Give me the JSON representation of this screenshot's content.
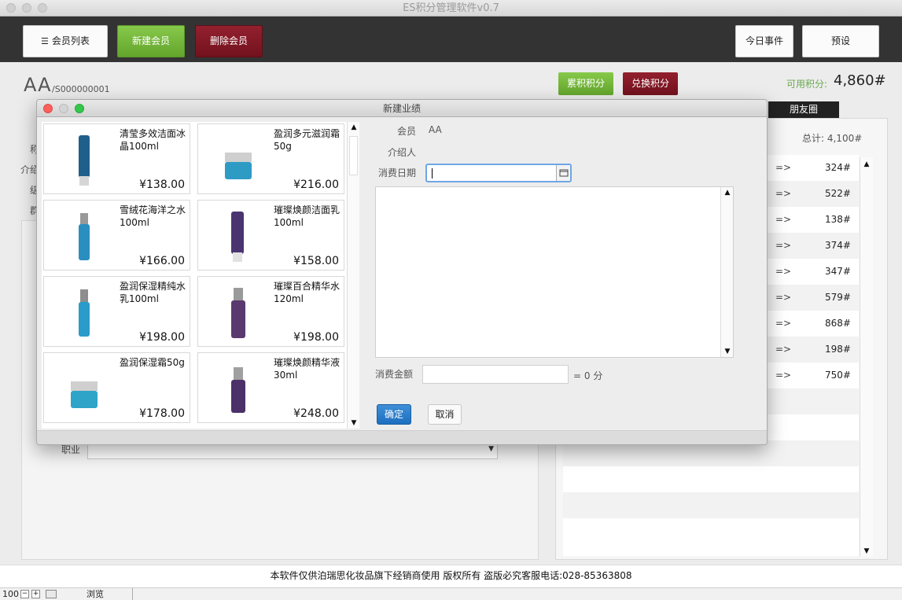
{
  "window": {
    "title": "ES积分管理软件v0.7"
  },
  "toolbar": {
    "member_list": "会员列表",
    "new_member": "新建会员",
    "delete_member": "删除会员",
    "today_events": "今日事件",
    "preset": "预设"
  },
  "member": {
    "name": "AA",
    "id": "/S000000001",
    "accumulate_label": "累积积分",
    "exchange_label": "兑换积分",
    "available_label": "可用积分:",
    "available_value": "4,860#",
    "field_labels": [
      "称",
      "介绍",
      "级",
      "群"
    ],
    "occupation_label": "职业"
  },
  "right_panel": {
    "tab_friends": "朋友圈",
    "total": "总计: 4,100#",
    "rows": [
      {
        "arrow": "=>",
        "points": "324#"
      },
      {
        "arrow": "=>",
        "points": "522#"
      },
      {
        "arrow": "=>",
        "points": "138#"
      },
      {
        "arrow": "=>",
        "points": "374#"
      },
      {
        "arrow": "=>",
        "points": "347#"
      },
      {
        "arrow": "=>",
        "points": "579#"
      },
      {
        "arrow": "=>",
        "points": "868#"
      },
      {
        "arrow": "=>",
        "points": "198#"
      },
      {
        "arrow": "=>",
        "points": "750#"
      }
    ]
  },
  "footer": {
    "text": "本软件仅供泊瑞思化妆品旗下经销商使用 版权所有 盗版必究客服电话:028-85363808"
  },
  "statusbar": {
    "zoom": "100",
    "mode": "浏览"
  },
  "dialog": {
    "title": "新建业绩",
    "member_label": "会员",
    "member_value": "AA",
    "referrer_label": "介绍人",
    "date_label": "消费日期",
    "amount_label": "消费金额",
    "amount_points": "= 0 分",
    "ok": "确定",
    "cancel": "取消",
    "products": [
      {
        "name": "清莹多效洁面冰晶100ml",
        "price": "¥138.00",
        "color": "#1f5f8c"
      },
      {
        "name": "盈润多元滋润霜50g",
        "price": "¥216.00",
        "color": "#2e9bc4"
      },
      {
        "name": "雪绒花海洋之水100ml",
        "price": "¥166.00",
        "color": "#2a8fc0"
      },
      {
        "name": "璀璨焕颜洁面乳100ml",
        "price": "¥158.00",
        "color": "#4a3470"
      },
      {
        "name": "盈润保湿精纯水乳100ml",
        "price": "¥198.00",
        "color": "#2a9bcb"
      },
      {
        "name": "璀璨百合精华水120ml",
        "price": "¥198.00",
        "color": "#5a3a6e"
      },
      {
        "name": "盈润保湿霜50g",
        "price": "¥178.00",
        "color": "#2ea4c9"
      },
      {
        "name": "璀璨焕颜精华液30ml",
        "price": "¥248.00",
        "color": "#4b3168"
      }
    ]
  }
}
